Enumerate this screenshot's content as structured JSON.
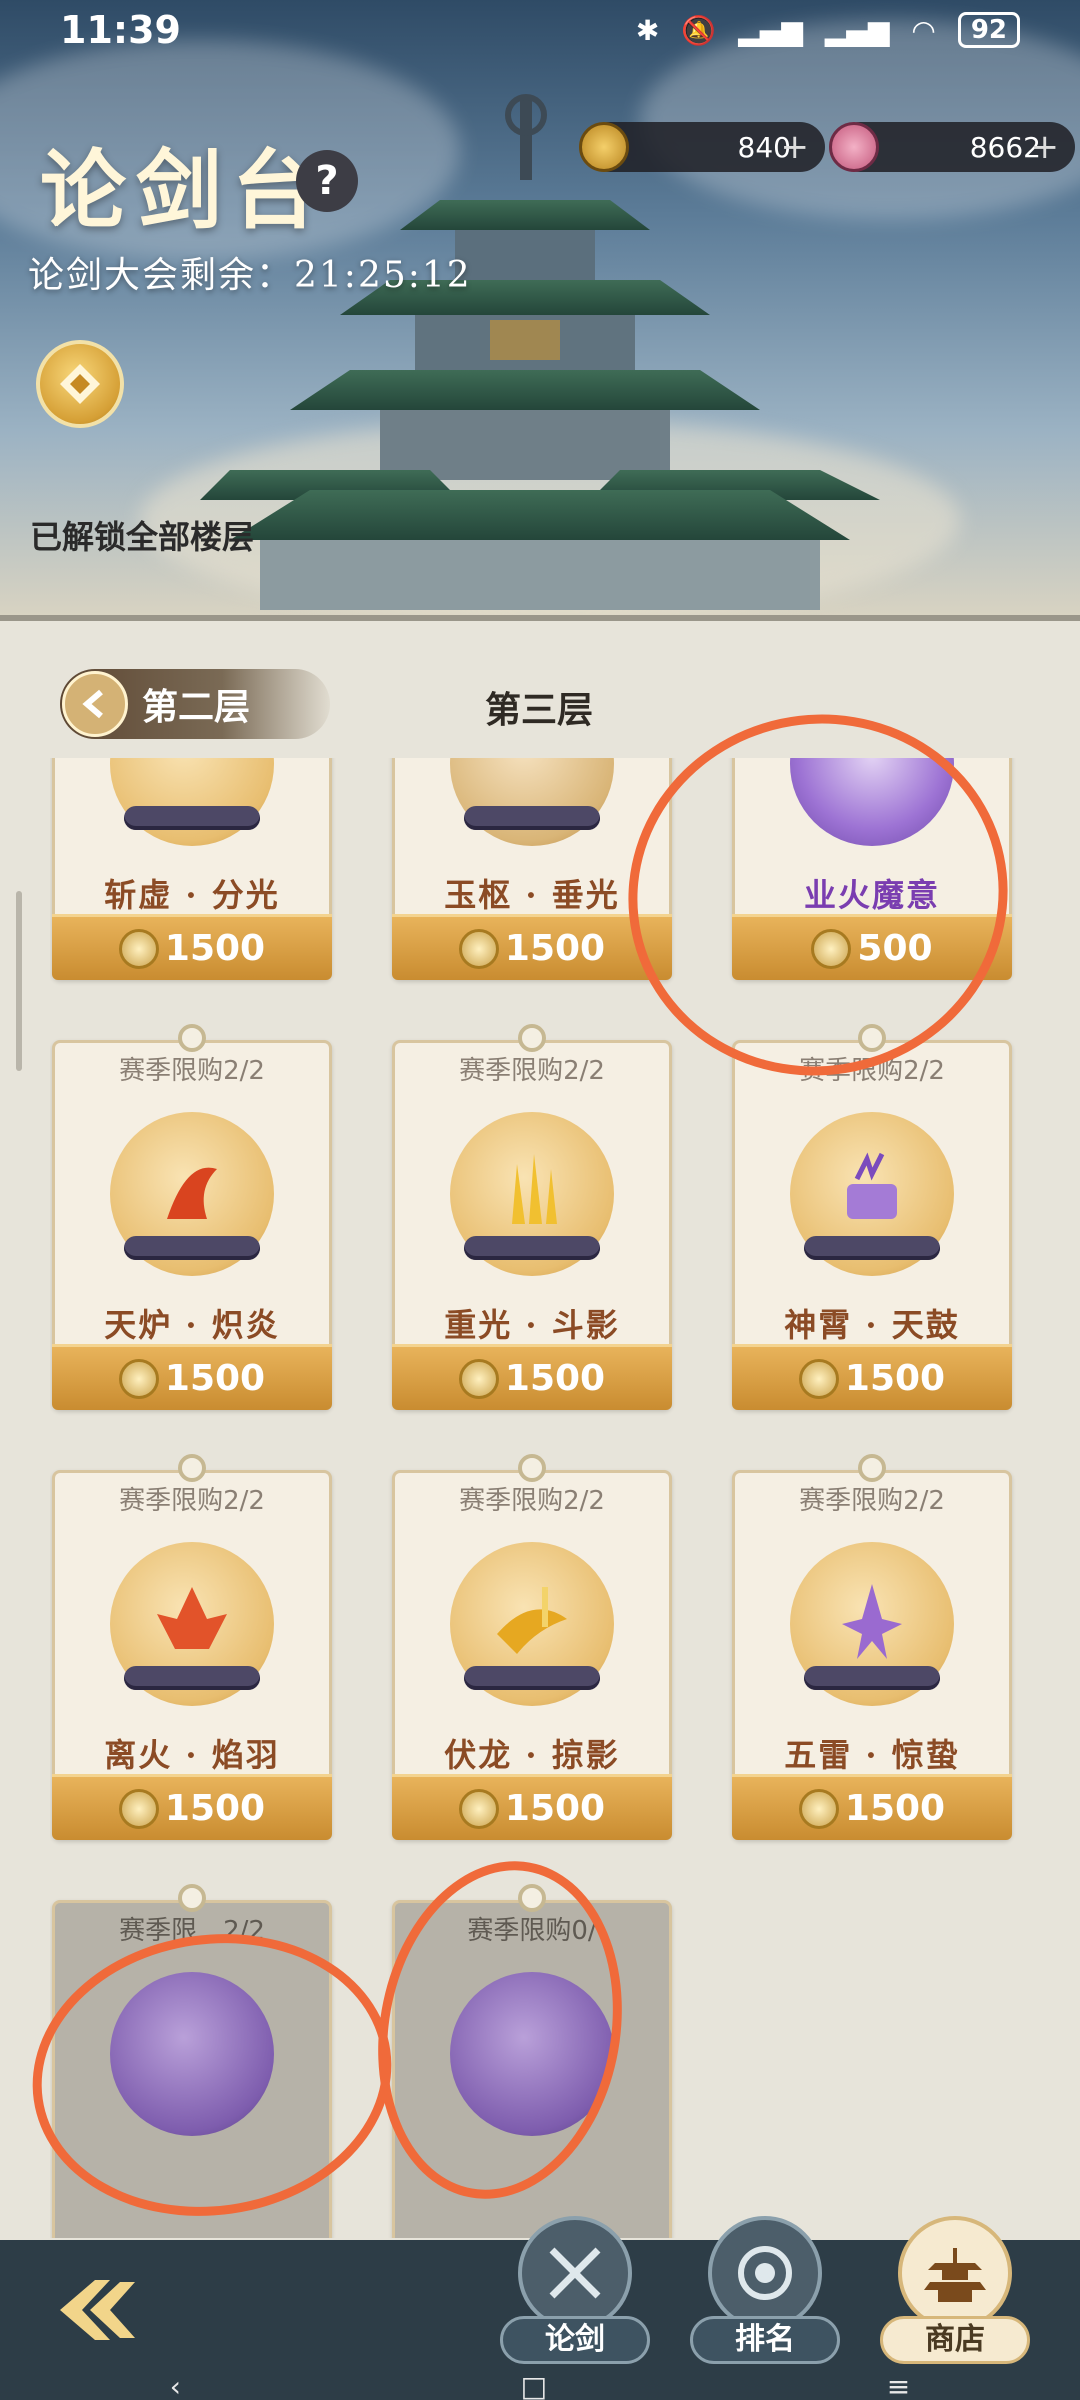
{
  "status": {
    "time": "11:39",
    "battery": "92"
  },
  "header": {
    "title": "论剑台",
    "help": "?",
    "countdown_label": "论剑大会剩余：21:25:12",
    "unlock_text": "已解锁全部楼层"
  },
  "currencies": [
    {
      "icon": "coin-icon",
      "value": "840"
    },
    {
      "icon": "feather-icon",
      "value": "8662"
    }
  ],
  "tabs": {
    "back_label": "第二层",
    "current_label": "第三层"
  },
  "cards": [
    {
      "name": "斩虚 · 分光",
      "price": "1500",
      "limit": ""
    },
    {
      "name": "玉枢 · 垂光",
      "price": "1500",
      "limit": ""
    },
    {
      "name": "业火魔意",
      "price": "500",
      "limit": ""
    },
    {
      "name": "天炉 · 炽炎",
      "price": "1500",
      "limit": "赛季限购2/2"
    },
    {
      "name": "重光 · 斗影",
      "price": "1500",
      "limit": "赛季限购2/2"
    },
    {
      "name": "神霄 · 天鼓",
      "price": "1500",
      "limit": "赛季限购2/2"
    },
    {
      "name": "离火 · 焰羽",
      "price": "1500",
      "limit": "赛季限购2/2"
    },
    {
      "name": "伏龙 · 掠影",
      "price": "1500",
      "limit": "赛季限购2/2"
    },
    {
      "name": "五雷 · 惊蛰",
      "price": "1500",
      "limit": "赛季限购2/2"
    },
    {
      "name": "",
      "price": "",
      "limit": "赛季限…2/2"
    },
    {
      "name": "",
      "price": "",
      "limit": "赛季限购0/"
    }
  ],
  "nav": {
    "duel": "论剑",
    "rank": "排名",
    "shop": "商店"
  },
  "colors": {
    "accent_gold": "#c98c30",
    "name_brown": "#8b4b25",
    "annotation_orange": "#f06a3a",
    "nav_bg": "#2d3d47"
  }
}
